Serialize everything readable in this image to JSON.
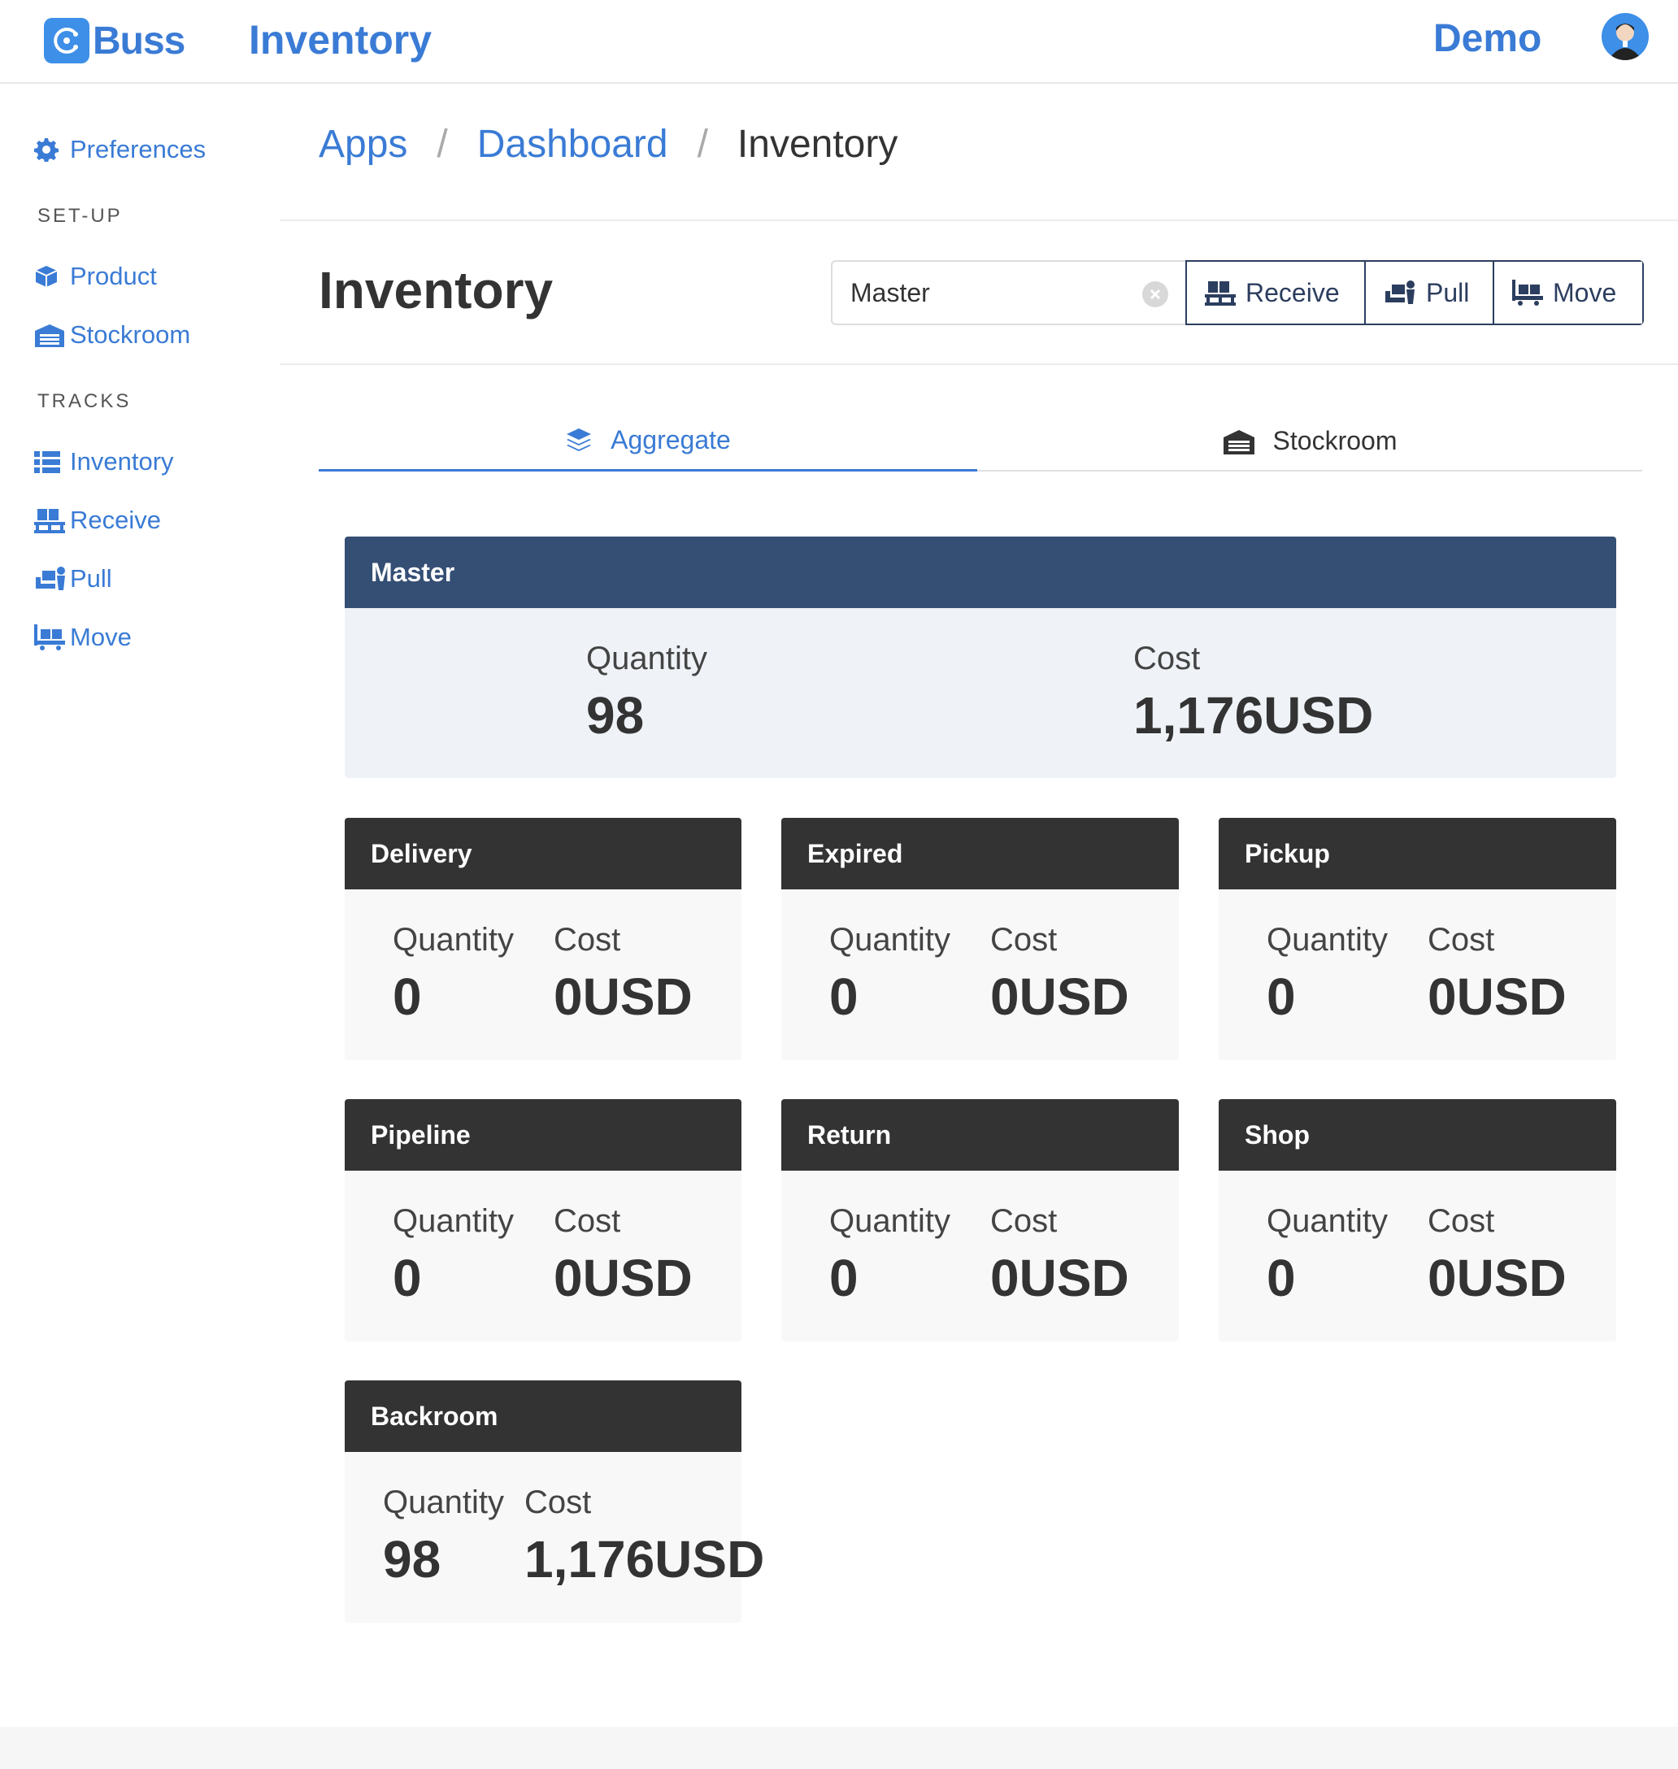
{
  "topbar": {
    "brand": "Buss",
    "app_title": "Inventory",
    "user": "Demo"
  },
  "sidebar": {
    "preferences": "Preferences",
    "setup_heading": "SET-UP",
    "setup_items": [
      "Product",
      "Stockroom"
    ],
    "tracks_heading": "TRACKS",
    "tracks_items": [
      "Inventory",
      "Receive",
      "Pull",
      "Move"
    ]
  },
  "breadcrumb": [
    "Apps",
    "Dashboard",
    "Inventory"
  ],
  "page": {
    "title": "Inventory",
    "search_value": "Master",
    "actions": [
      "Receive",
      "Pull",
      "Move"
    ]
  },
  "tabs": [
    "Aggregate",
    "Stockroom"
  ],
  "labels": {
    "quantity": "Quantity",
    "cost": "Cost"
  },
  "master": {
    "name": "Master",
    "quantity": "98",
    "cost": "1,176USD"
  },
  "stockrooms": [
    {
      "name": "Delivery",
      "quantity": "0",
      "cost": "0USD"
    },
    {
      "name": "Expired",
      "quantity": "0",
      "cost": "0USD"
    },
    {
      "name": "Pickup",
      "quantity": "0",
      "cost": "0USD"
    },
    {
      "name": "Pipeline",
      "quantity": "0",
      "cost": "0USD"
    },
    {
      "name": "Return",
      "quantity": "0",
      "cost": "0USD"
    },
    {
      "name": "Shop",
      "quantity": "0",
      "cost": "0USD"
    },
    {
      "name": "Backroom",
      "quantity": "98",
      "cost": "1,176USD"
    }
  ],
  "colors": {
    "accent": "#3a7bd5",
    "master_header": "#344e74",
    "card_header": "#333333",
    "button_border": "#2c3e5f"
  },
  "icons": {
    "preferences": "gear-icon",
    "product": "cube-icon",
    "stockroom": "warehouse-icon",
    "inventory": "list-icon",
    "receive": "dolly-flatbed-icon",
    "pull": "people-carry-icon",
    "move": "pallet-icon",
    "aggregate": "layers-icon",
    "clear": "clear-icon"
  }
}
